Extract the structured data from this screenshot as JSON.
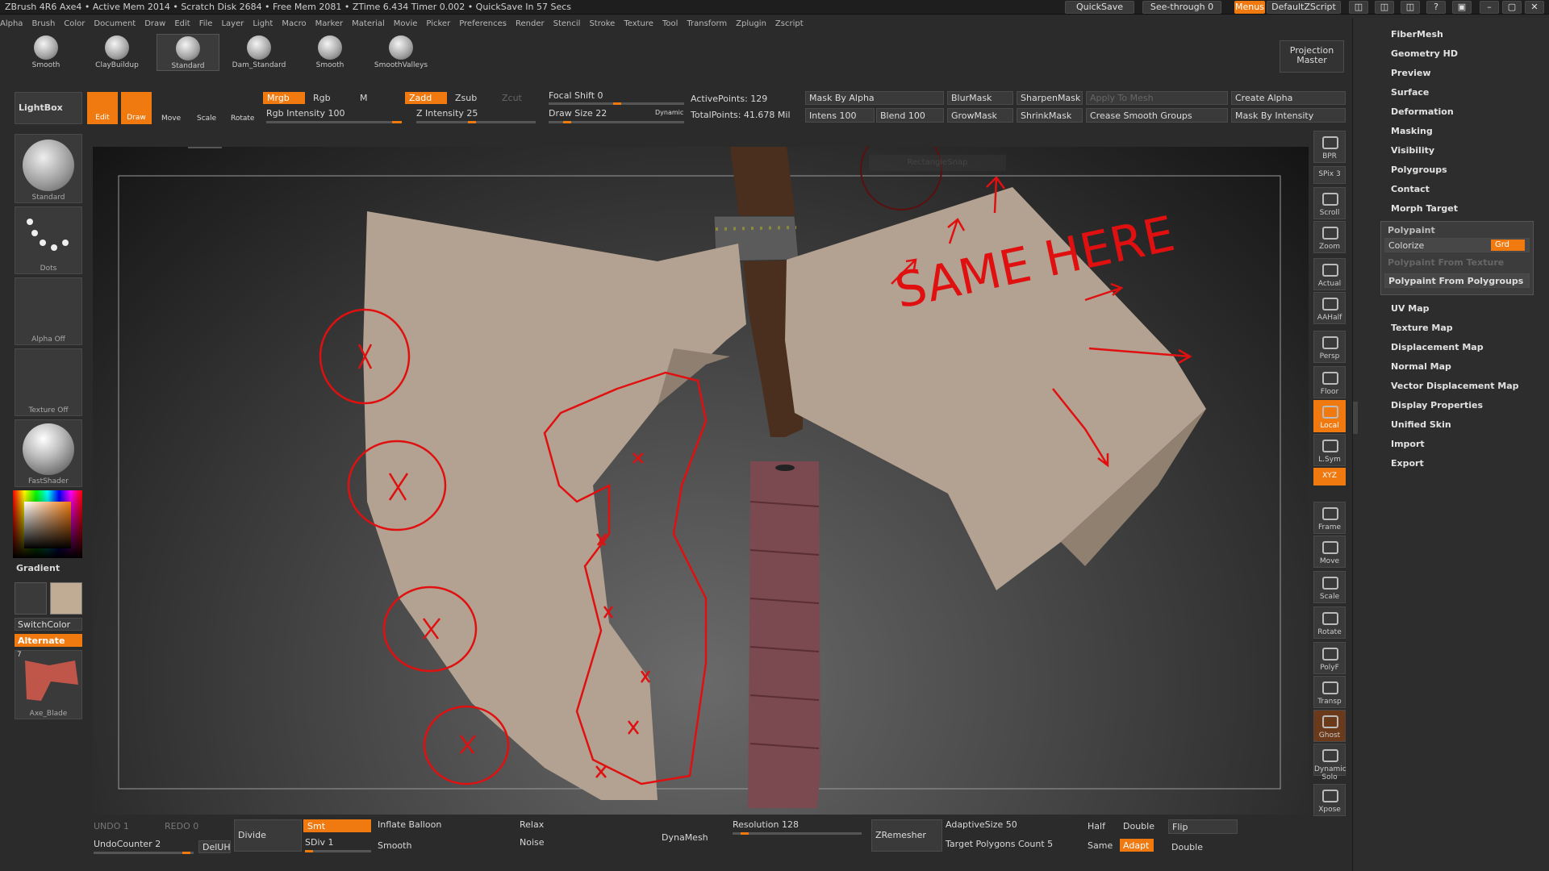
{
  "titlebar": {
    "text": "ZBrush 4R6    Axe4   • Active Mem 2014 • Scratch Disk 2684 • Free Mem 2081 • ZTime 6.434 Timer 0.002 • QuickSave In 57 Secs",
    "quicksave": "QuickSave",
    "seethrough": "See-through  0",
    "menus": "Menus",
    "defaultscript": "DefaultZScript"
  },
  "menubar": [
    "Alpha",
    "Brush",
    "Color",
    "Document",
    "Draw",
    "Edit",
    "File",
    "Layer",
    "Light",
    "Macro",
    "Marker",
    "Material",
    "Movie",
    "Picker",
    "Preferences",
    "Render",
    "Stencil",
    "Stroke",
    "Texture",
    "Tool",
    "Transform",
    "Zplugin",
    "Zscript"
  ],
  "brushes": [
    "Smooth",
    "ClayBuildup",
    "Standard",
    "Dam_Standard",
    "Smooth",
    "SmoothValleys"
  ],
  "projection_master": "Projection Master",
  "toolbar": {
    "lightbox": "LightBox",
    "edit": "Edit",
    "draw": "Draw",
    "move": "Move",
    "scale": "Scale",
    "rotate": "Rotate",
    "mrgb": "Mrgb",
    "rgb": "Rgb",
    "m": "M",
    "rgb_intensity": "Rgb Intensity 100",
    "zadd": "Zadd",
    "zsub": "Zsub",
    "zcut": "Zcut",
    "z_intensity": "Z Intensity 25",
    "focal_shift": "Focal Shift 0",
    "draw_size": "Draw Size 22",
    "dynamic": "Dynamic",
    "active_points": "ActivePoints: 129",
    "total_points": "TotalPoints: 41.678 Mil",
    "mask_by_alpha": "Mask By Alpha",
    "intens": "Intens 100",
    "blend": "Blend 100",
    "blurmask": "BlurMask",
    "sharpenmask": "SharpenMask",
    "apply_to_mesh": "Apply To Mesh",
    "growmask": "GrowMask",
    "shrinkmask": "ShrinkMask",
    "crease_smooth_groups": "Crease Smooth Groups",
    "create_alpha": "Create Alpha",
    "mask_by_intensity": "Mask By Intensity"
  },
  "left_shelf": {
    "brush": "Standard",
    "stroke": "Dots",
    "alpha": "Alpha Off",
    "texture": "Texture Off",
    "material": "FastShader",
    "gradient": "Gradient",
    "switchcolor": "SwitchColor",
    "alternate": "Alternate",
    "tool": "Axe_Blade",
    "tool_count": "7"
  },
  "canvas": {
    "annotation": "SAME HERE",
    "ghost_label": "RectangleSnap"
  },
  "right_shelf": [
    "BPR",
    "SPix 3",
    "Scroll",
    "Zoom",
    "Actual",
    "AAHalf",
    "Persp",
    "Floor",
    "Local",
    "L.Sym",
    "XYZ",
    "Frame",
    "Move",
    "Scale",
    "Rotate",
    "PolyF",
    "Transp",
    "Ghost",
    "Dynamic Solo",
    "Xpose"
  ],
  "right_panel": {
    "items_top": [
      "FiberMesh",
      "Geometry HD",
      "Preview",
      "Surface",
      "Deformation",
      "Masking",
      "Visibility",
      "Polygroups",
      "Contact",
      "Morph Target"
    ],
    "polypaint": "Polypaint",
    "colorize": "Colorize",
    "grd": "Grd",
    "pp_from_texture": "Polypaint From Texture",
    "pp_from_polygroups": "Polypaint From Polygroups",
    "items_bottom": [
      "UV Map",
      "Texture Map",
      "Displacement Map",
      "Normal Map",
      "Vector Displacement Map",
      "Display Properties",
      "Unified Skin",
      "Import",
      "Export"
    ]
  },
  "bottom": {
    "undo": "UNDO 1",
    "redo": "REDO 0",
    "undocounter": "UndoCounter 2",
    "deluh": "DelUH",
    "divide": "Divide",
    "smt": "Smt",
    "sdiv": "SDiv 1",
    "inflate_balloon": "Inflate Balloon",
    "smooth": "Smooth",
    "relax": "Relax",
    "noise": "Noise",
    "dynamesh": "DynaMesh",
    "resolution": "Resolution 128",
    "zremesher": "ZRemesher",
    "adaptive_size": "AdaptiveSize 50",
    "target_polygons": "Target Polygons Count 5",
    "half": "Half",
    "same": "Same",
    "double": "Double",
    "adapt": "Adapt",
    "flip": "Flip",
    "double2": "Double"
  }
}
